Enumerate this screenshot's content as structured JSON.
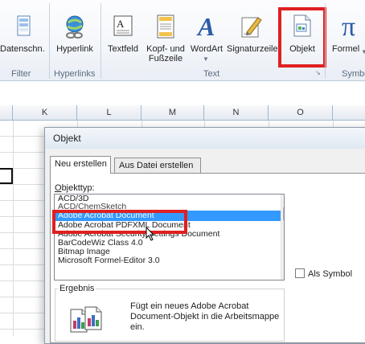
{
  "ribbon": {
    "buttons": [
      {
        "id": "datenschnitt",
        "label": "Datenschn.",
        "icon": "slicer-icon"
      },
      {
        "id": "hyperlink",
        "label": "Hyperlink",
        "icon": "hyperlink-icon"
      },
      {
        "id": "textfeld",
        "label": "Textfeld",
        "icon": "textbox-icon"
      },
      {
        "id": "kopfzeile",
        "label": "Kopf- und",
        "label2": "Fußzeile",
        "icon": "header-footer-icon"
      },
      {
        "id": "wordart",
        "label": "WordArt",
        "icon": "wordart-icon"
      },
      {
        "id": "signaturzeile",
        "label": "Signaturzeile",
        "icon": "signature-line-icon"
      },
      {
        "id": "objekt",
        "label": "Objekt",
        "icon": "object-icon"
      },
      {
        "id": "formel",
        "label": "Formel",
        "icon": "pi-formula-icon"
      }
    ],
    "groups": {
      "filter": "Filter",
      "hyperlinks": "Hyperlinks",
      "text": "Text",
      "symbole": "Symbo"
    }
  },
  "sheet": {
    "columns": [
      "K",
      "L",
      "M",
      "N",
      "O"
    ]
  },
  "dialog": {
    "title": "Objekt",
    "tabs": [
      "Neu erstellen",
      "Aus Datei erstellen"
    ],
    "objekttyp_label_u": "O",
    "objekttyp_label_rest": "bjekttyp:",
    "items": [
      "ACD/3D",
      "ACD/ChemSketch",
      "Adobe Acrobat Document",
      "Adobe Acrobat PDFXML Document",
      "Adobe Acrobat Security Settings Document",
      "BarCodeWiz Class 4.0",
      "Bitmap Image",
      "Microsoft Formel-Editor 3.0"
    ],
    "selected_index": 2,
    "checkbox_label": "Als Symbol",
    "checkbox_checked": false,
    "result_label": "Ergebnis",
    "result_text": "Fügt ein neues Adobe Acrobat Document-Objekt in die Arbeitsmappe ein."
  },
  "colors": {
    "highlight": "#e02020",
    "selection": "#3399ff"
  }
}
